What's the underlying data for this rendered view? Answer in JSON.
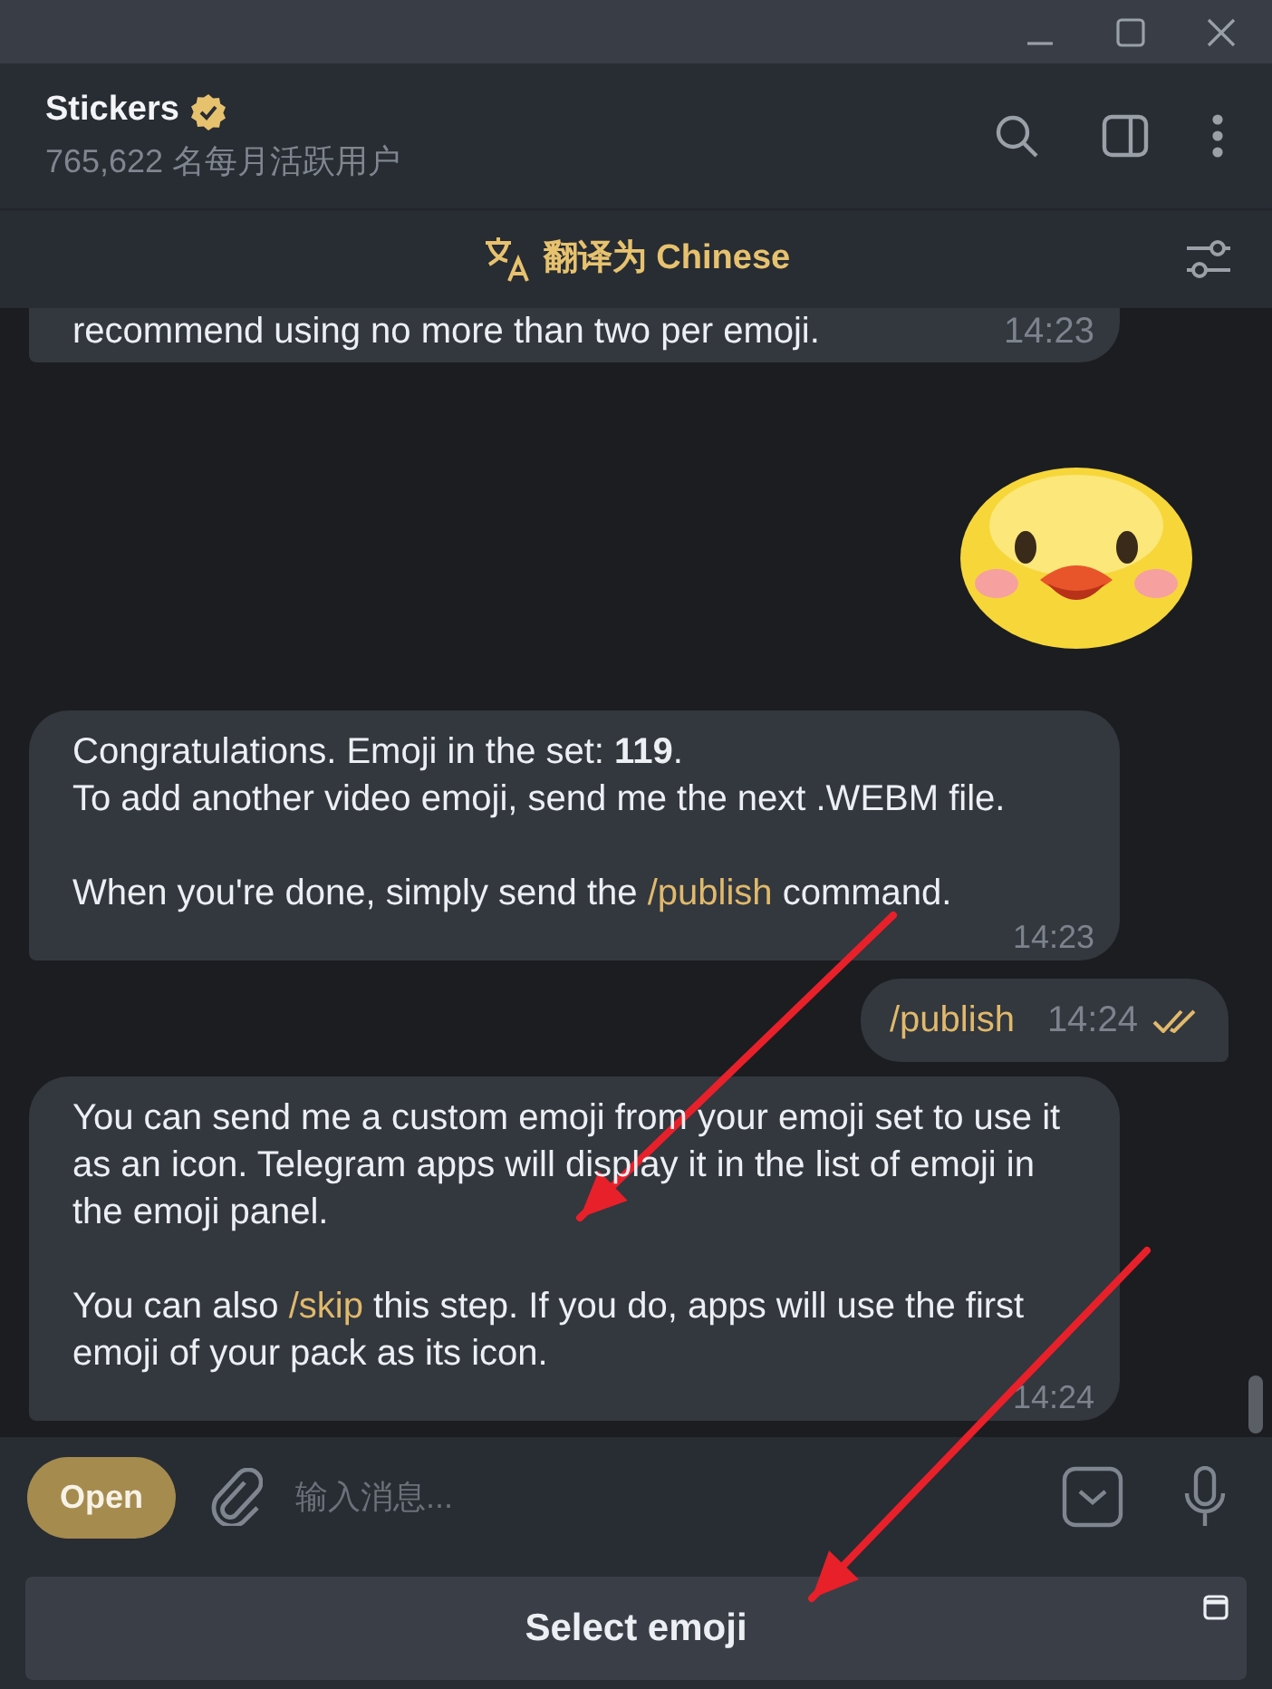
{
  "header": {
    "title": "Stickers",
    "verified": true,
    "subtitle": "765,622 名每月活跃用户"
  },
  "translate_bar": {
    "label": "翻译为 Chinese"
  },
  "messages": [
    {
      "kind": "incoming",
      "cut": true,
      "paragraphs": [
        [
          {
            "kind": "text",
            "text": "recommend using no more than two per emoji."
          }
        ]
      ],
      "time": "14:23"
    },
    {
      "kind": "sticker"
    },
    {
      "kind": "incoming",
      "paragraphs": [
        [
          {
            "kind": "text",
            "text": "Congratulations. Emoji in the set: **119**.\nTo add another video emoji, send me the next .WEBM file."
          }
        ],
        [
          {
            "kind": "text",
            "text": "When you're done, simply send the "
          },
          {
            "kind": "command",
            "text": "/publish"
          },
          {
            "kind": "text",
            "text": " command."
          }
        ]
      ],
      "time": "14:23"
    },
    {
      "kind": "outgoing",
      "paragraphs": [
        [
          {
            "kind": "command",
            "text": "/publish"
          }
        ]
      ],
      "time": "14:24",
      "read": true
    },
    {
      "kind": "incoming",
      "paragraphs": [
        [
          {
            "kind": "text",
            "text": "You can send me a custom emoji from your emoji set to use it as an icon. Telegram apps will display it in the list of emoji in the emoji panel."
          }
        ],
        [
          {
            "kind": "text",
            "text": "You can also "
          },
          {
            "kind": "command",
            "text": "/skip"
          },
          {
            "kind": "text",
            "text": " this step. If you do, apps will use the first emoji of your pack as its icon."
          }
        ]
      ],
      "time": "14:24"
    }
  ],
  "composer": {
    "open_button": "Open",
    "placeholder": "输入消息..."
  },
  "keyboard_button": {
    "label": "Select emoji"
  },
  "annotations": [
    {
      "kind": "arrow"
    },
    {
      "kind": "arrow"
    }
  ]
}
